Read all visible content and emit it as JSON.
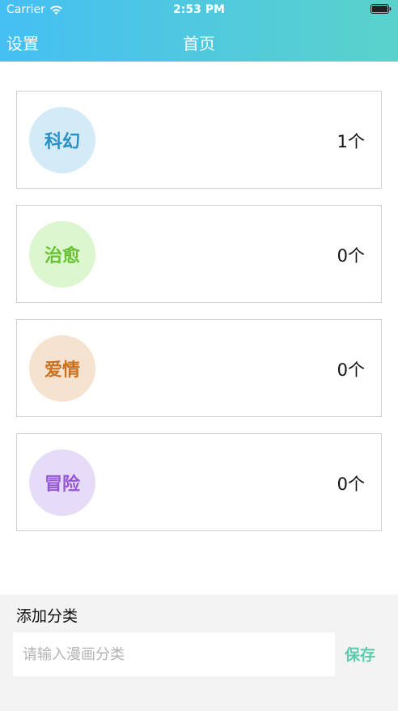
{
  "status_bar": {
    "carrier": "Carrier",
    "time": "2:53 PM"
  },
  "nav": {
    "left_label": "设置",
    "title": "首页"
  },
  "categories": [
    {
      "name": "科幻",
      "count": "1个",
      "circle_bg": "#d3ebf6",
      "text_color": "#2b8fc4"
    },
    {
      "name": "治愈",
      "count": "0个",
      "circle_bg": "#dcf6d0",
      "text_color": "#69c233"
    },
    {
      "name": "爱情",
      "count": "0个",
      "circle_bg": "#f5e2cf",
      "text_color": "#c9711f"
    },
    {
      "name": "冒险",
      "count": "0个",
      "circle_bg": "#e7dcf8",
      "text_color": "#9555d9"
    }
  ],
  "add_category": {
    "label": "添加分类",
    "input_value": "",
    "placeholder": "请输入漫画分类",
    "save_label": "保存"
  },
  "colors": {
    "header_gradient_start": "#45bff3",
    "header_gradient_end": "#5ad2cb",
    "save_color": "#5fcbae"
  },
  "icons": {
    "wifi": "wifi-icon",
    "battery": "battery-icon"
  }
}
